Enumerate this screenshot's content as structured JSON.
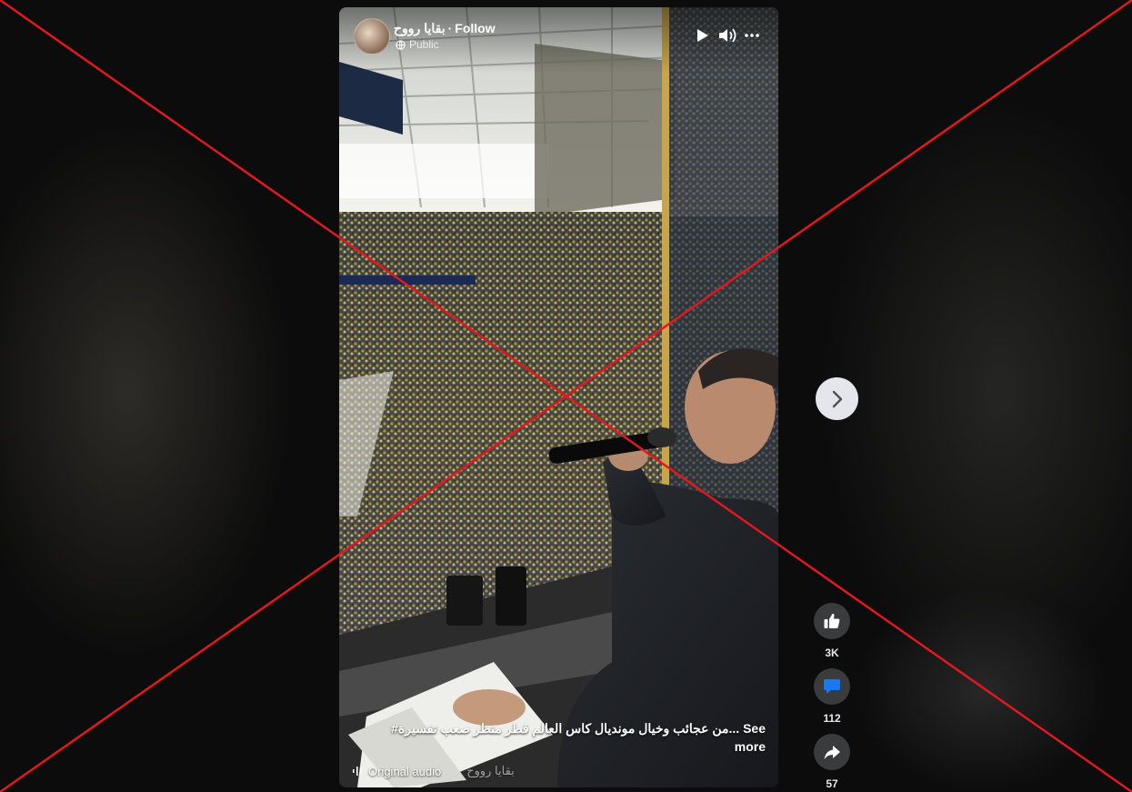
{
  "post": {
    "author": "بقايا رووح",
    "separator": "·",
    "follow_label": "Follow",
    "audience": "Public"
  },
  "caption": {
    "text": "#من عجائب وخيال مونديال كاس العالم قطر منظر صعب تفسيرة... See more"
  },
  "audio": {
    "label": "Original audio",
    "author": "بقايا رووح"
  },
  "actions": {
    "likes": "3K",
    "comments": "112",
    "shares": "57"
  },
  "icons": {
    "play": "play-icon",
    "volume": "volume-icon",
    "more": "more-icon",
    "next": "chevron-right-icon",
    "like": "thumbs-up-icon",
    "comment": "comment-icon",
    "share": "share-icon",
    "audience": "globe-icon",
    "audio": "audio-wave-icon"
  },
  "colors": {
    "comment_accent": "#1877f2",
    "action_bg": "#3a3b3c",
    "cross_overlay": "#e0191e"
  }
}
